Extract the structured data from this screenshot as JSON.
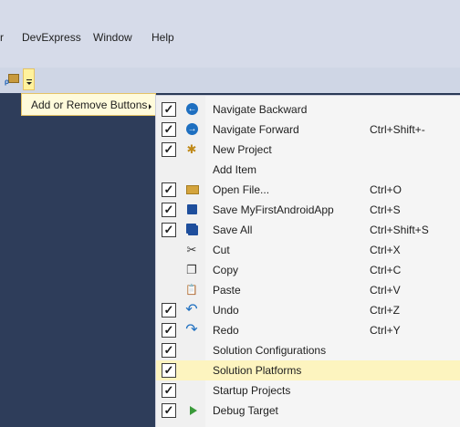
{
  "menubar": {
    "items": [
      "r",
      "DevExpress",
      "Window",
      "Help"
    ]
  },
  "toolbar": {
    "add_remove_label": "Add or Remove Buttons"
  },
  "menu": {
    "items": [
      {
        "label": "Navigate Backward",
        "shortcut": "",
        "checked": true,
        "icon": "arrow-left-icon"
      },
      {
        "label": "Navigate Forward",
        "shortcut": "Ctrl+Shift+-",
        "checked": true,
        "icon": "arrow-right-icon"
      },
      {
        "label": "New Project",
        "shortcut": "",
        "checked": true,
        "icon": "new-project-icon"
      },
      {
        "label": "Add Item",
        "shortcut": "",
        "checked": false,
        "icon": ""
      },
      {
        "label": "Open File...",
        "shortcut": "Ctrl+O",
        "checked": true,
        "icon": "open-folder-icon"
      },
      {
        "label": "Save MyFirstAndroidApp",
        "shortcut": "Ctrl+S",
        "checked": true,
        "icon": "save-icon"
      },
      {
        "label": "Save All",
        "shortcut": "Ctrl+Shift+S",
        "checked": true,
        "icon": "save-all-icon"
      },
      {
        "label": "Cut",
        "shortcut": "Ctrl+X",
        "checked": false,
        "icon": "scissors-icon"
      },
      {
        "label": "Copy",
        "shortcut": "Ctrl+C",
        "checked": false,
        "icon": "copy-icon"
      },
      {
        "label": "Paste",
        "shortcut": "Ctrl+V",
        "checked": false,
        "icon": "paste-icon"
      },
      {
        "label": "Undo",
        "shortcut": "Ctrl+Z",
        "checked": true,
        "icon": "undo-icon"
      },
      {
        "label": "Redo",
        "shortcut": "Ctrl+Y",
        "checked": true,
        "icon": "redo-icon"
      },
      {
        "label": "Solution Configurations",
        "shortcut": "",
        "checked": true,
        "icon": ""
      },
      {
        "label": "Solution Platforms",
        "shortcut": "",
        "checked": true,
        "icon": "",
        "highlighted": true
      },
      {
        "label": "Startup Projects",
        "shortcut": "",
        "checked": true,
        "icon": ""
      },
      {
        "label": "Debug Target",
        "shortcut": "",
        "checked": true,
        "icon": "play-icon"
      }
    ]
  },
  "colors": {
    "highlight": "#fdf4bf",
    "menubar_bg": "#d6dbe9",
    "workspace_bg": "#293955"
  }
}
